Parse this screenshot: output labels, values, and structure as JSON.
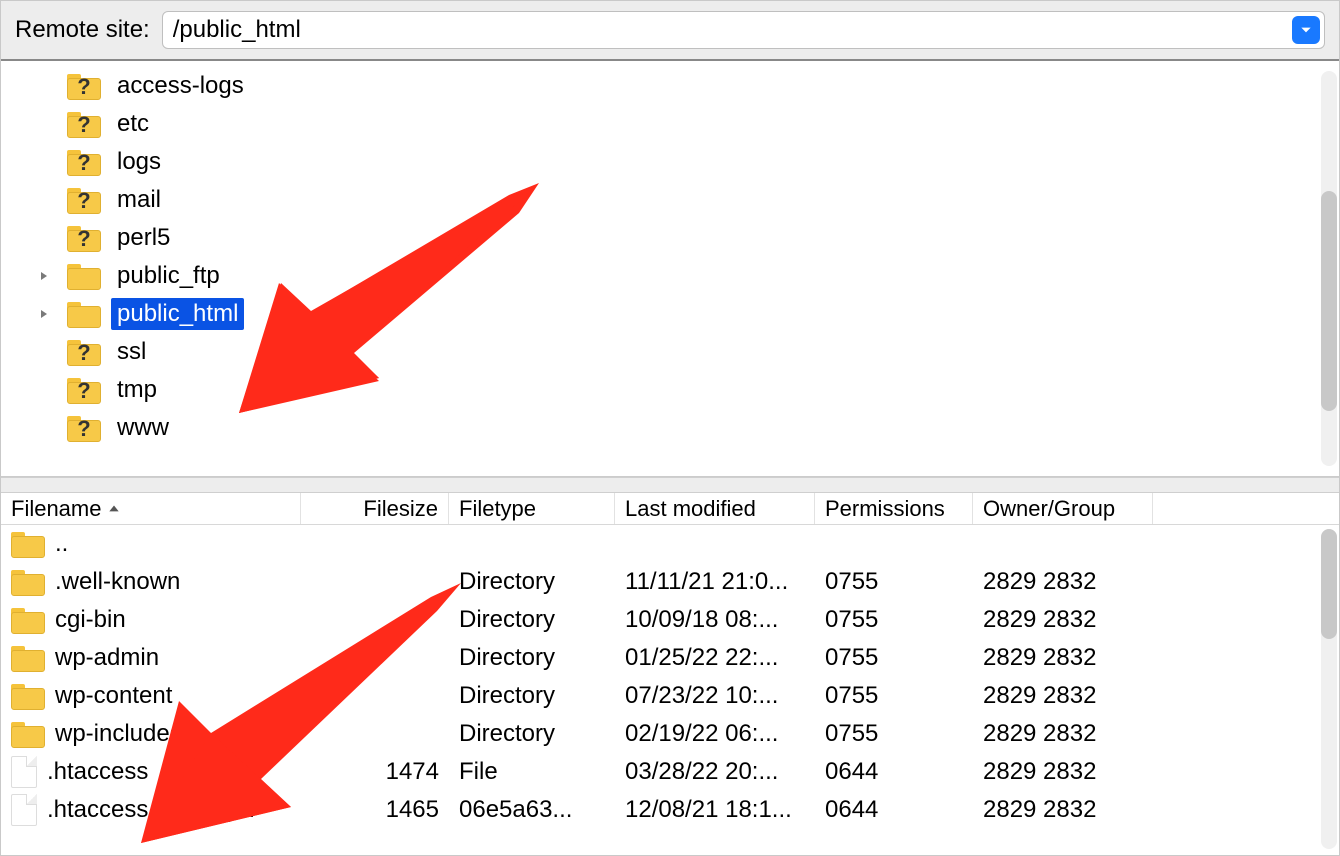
{
  "address": {
    "label": "Remote site:",
    "value": "/public_html"
  },
  "tree": {
    "items": [
      {
        "name": "access-logs",
        "icon": "unknown-folder",
        "expandable": false
      },
      {
        "name": "etc",
        "icon": "unknown-folder",
        "expandable": false
      },
      {
        "name": "logs",
        "icon": "unknown-folder",
        "expandable": false
      },
      {
        "name": "mail",
        "icon": "unknown-folder",
        "expandable": false
      },
      {
        "name": "perl5",
        "icon": "unknown-folder",
        "expandable": false
      },
      {
        "name": "public_ftp",
        "icon": "folder",
        "expandable": true
      },
      {
        "name": "public_html",
        "icon": "folder",
        "expandable": true,
        "selected": true
      },
      {
        "name": "ssl",
        "icon": "unknown-folder",
        "expandable": false
      },
      {
        "name": "tmp",
        "icon": "unknown-folder",
        "expandable": false
      },
      {
        "name": "www",
        "icon": "unknown-folder",
        "expandable": false
      }
    ]
  },
  "files": {
    "columns": {
      "name": "Filename",
      "size": "Filesize",
      "type": "Filetype",
      "modified": "Last modified",
      "permissions": "Permissions",
      "owner": "Owner/Group"
    },
    "sort": {
      "column": "name",
      "dir": "asc"
    },
    "rows": [
      {
        "name": "..",
        "icon": "folder",
        "size": "",
        "type": "",
        "modified": "",
        "permissions": "",
        "owner": ""
      },
      {
        "name": ".well-known",
        "icon": "folder",
        "size": "",
        "type": "Directory",
        "modified": "11/11/21 21:0...",
        "permissions": "0755",
        "owner": "2829 2832"
      },
      {
        "name": "cgi-bin",
        "icon": "folder",
        "size": "",
        "type": "Directory",
        "modified": "10/09/18 08:...",
        "permissions": "0755",
        "owner": "2829 2832"
      },
      {
        "name": "wp-admin",
        "icon": "folder",
        "size": "",
        "type": "Directory",
        "modified": "01/25/22 22:...",
        "permissions": "0755",
        "owner": "2829 2832"
      },
      {
        "name": "wp-content",
        "icon": "folder",
        "size": "",
        "type": "Directory",
        "modified": "07/23/22 10:...",
        "permissions": "0755",
        "owner": "2829 2832"
      },
      {
        "name": "wp-includes",
        "icon": "folder",
        "size": "",
        "type": "Directory",
        "modified": "02/19/22 06:...",
        "permissions": "0755",
        "owner": "2829 2832"
      },
      {
        "name": ".htaccess",
        "icon": "file",
        "size": "1474",
        "type": "File",
        "modified": "03/28/22 20:...",
        "permissions": "0644",
        "owner": "2829 2832"
      },
      {
        "name": ".htaccess.phpupg...",
        "icon": "file",
        "size": "1465",
        "type": "06e5a63...",
        "modified": "12/08/21 18:1...",
        "permissions": "0644",
        "owner": "2829 2832"
      }
    ]
  }
}
